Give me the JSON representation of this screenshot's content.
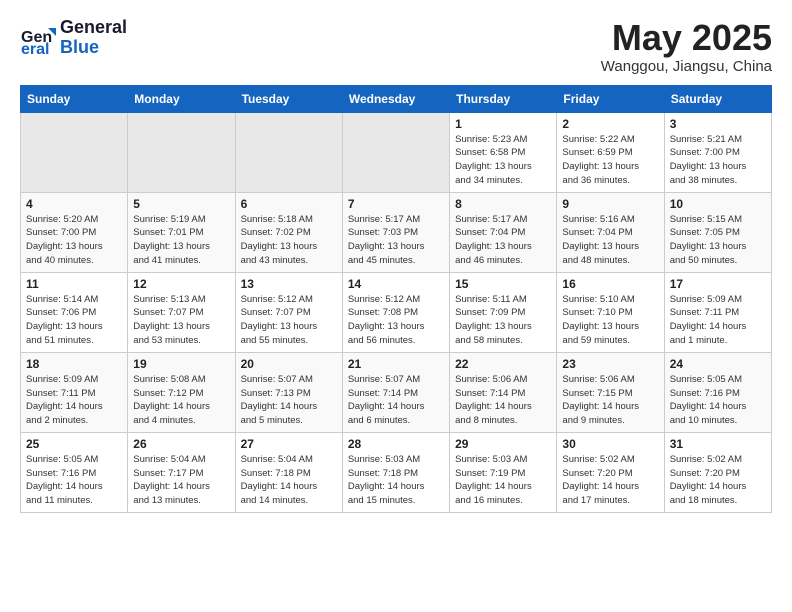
{
  "header": {
    "logo_line1": "General",
    "logo_line2": "Blue",
    "month": "May 2025",
    "location": "Wanggou, Jiangsu, China"
  },
  "weekdays": [
    "Sunday",
    "Monday",
    "Tuesday",
    "Wednesday",
    "Thursday",
    "Friday",
    "Saturday"
  ],
  "weeks": [
    [
      {
        "day": "",
        "info": ""
      },
      {
        "day": "",
        "info": ""
      },
      {
        "day": "",
        "info": ""
      },
      {
        "day": "",
        "info": ""
      },
      {
        "day": "1",
        "info": "Sunrise: 5:23 AM\nSunset: 6:58 PM\nDaylight: 13 hours\nand 34 minutes."
      },
      {
        "day": "2",
        "info": "Sunrise: 5:22 AM\nSunset: 6:59 PM\nDaylight: 13 hours\nand 36 minutes."
      },
      {
        "day": "3",
        "info": "Sunrise: 5:21 AM\nSunset: 7:00 PM\nDaylight: 13 hours\nand 38 minutes."
      }
    ],
    [
      {
        "day": "4",
        "info": "Sunrise: 5:20 AM\nSunset: 7:00 PM\nDaylight: 13 hours\nand 40 minutes."
      },
      {
        "day": "5",
        "info": "Sunrise: 5:19 AM\nSunset: 7:01 PM\nDaylight: 13 hours\nand 41 minutes."
      },
      {
        "day": "6",
        "info": "Sunrise: 5:18 AM\nSunset: 7:02 PM\nDaylight: 13 hours\nand 43 minutes."
      },
      {
        "day": "7",
        "info": "Sunrise: 5:17 AM\nSunset: 7:03 PM\nDaylight: 13 hours\nand 45 minutes."
      },
      {
        "day": "8",
        "info": "Sunrise: 5:17 AM\nSunset: 7:04 PM\nDaylight: 13 hours\nand 46 minutes."
      },
      {
        "day": "9",
        "info": "Sunrise: 5:16 AM\nSunset: 7:04 PM\nDaylight: 13 hours\nand 48 minutes."
      },
      {
        "day": "10",
        "info": "Sunrise: 5:15 AM\nSunset: 7:05 PM\nDaylight: 13 hours\nand 50 minutes."
      }
    ],
    [
      {
        "day": "11",
        "info": "Sunrise: 5:14 AM\nSunset: 7:06 PM\nDaylight: 13 hours\nand 51 minutes."
      },
      {
        "day": "12",
        "info": "Sunrise: 5:13 AM\nSunset: 7:07 PM\nDaylight: 13 hours\nand 53 minutes."
      },
      {
        "day": "13",
        "info": "Sunrise: 5:12 AM\nSunset: 7:07 PM\nDaylight: 13 hours\nand 55 minutes."
      },
      {
        "day": "14",
        "info": "Sunrise: 5:12 AM\nSunset: 7:08 PM\nDaylight: 13 hours\nand 56 minutes."
      },
      {
        "day": "15",
        "info": "Sunrise: 5:11 AM\nSunset: 7:09 PM\nDaylight: 13 hours\nand 58 minutes."
      },
      {
        "day": "16",
        "info": "Sunrise: 5:10 AM\nSunset: 7:10 PM\nDaylight: 13 hours\nand 59 minutes."
      },
      {
        "day": "17",
        "info": "Sunrise: 5:09 AM\nSunset: 7:11 PM\nDaylight: 14 hours\nand 1 minute."
      }
    ],
    [
      {
        "day": "18",
        "info": "Sunrise: 5:09 AM\nSunset: 7:11 PM\nDaylight: 14 hours\nand 2 minutes."
      },
      {
        "day": "19",
        "info": "Sunrise: 5:08 AM\nSunset: 7:12 PM\nDaylight: 14 hours\nand 4 minutes."
      },
      {
        "day": "20",
        "info": "Sunrise: 5:07 AM\nSunset: 7:13 PM\nDaylight: 14 hours\nand 5 minutes."
      },
      {
        "day": "21",
        "info": "Sunrise: 5:07 AM\nSunset: 7:14 PM\nDaylight: 14 hours\nand 6 minutes."
      },
      {
        "day": "22",
        "info": "Sunrise: 5:06 AM\nSunset: 7:14 PM\nDaylight: 14 hours\nand 8 minutes."
      },
      {
        "day": "23",
        "info": "Sunrise: 5:06 AM\nSunset: 7:15 PM\nDaylight: 14 hours\nand 9 minutes."
      },
      {
        "day": "24",
        "info": "Sunrise: 5:05 AM\nSunset: 7:16 PM\nDaylight: 14 hours\nand 10 minutes."
      }
    ],
    [
      {
        "day": "25",
        "info": "Sunrise: 5:05 AM\nSunset: 7:16 PM\nDaylight: 14 hours\nand 11 minutes."
      },
      {
        "day": "26",
        "info": "Sunrise: 5:04 AM\nSunset: 7:17 PM\nDaylight: 14 hours\nand 13 minutes."
      },
      {
        "day": "27",
        "info": "Sunrise: 5:04 AM\nSunset: 7:18 PM\nDaylight: 14 hours\nand 14 minutes."
      },
      {
        "day": "28",
        "info": "Sunrise: 5:03 AM\nSunset: 7:18 PM\nDaylight: 14 hours\nand 15 minutes."
      },
      {
        "day": "29",
        "info": "Sunrise: 5:03 AM\nSunset: 7:19 PM\nDaylight: 14 hours\nand 16 minutes."
      },
      {
        "day": "30",
        "info": "Sunrise: 5:02 AM\nSunset: 7:20 PM\nDaylight: 14 hours\nand 17 minutes."
      },
      {
        "day": "31",
        "info": "Sunrise: 5:02 AM\nSunset: 7:20 PM\nDaylight: 14 hours\nand 18 minutes."
      }
    ]
  ]
}
